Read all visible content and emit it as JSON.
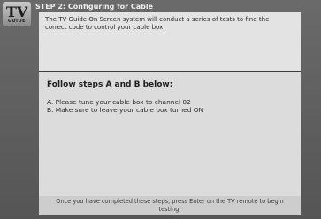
{
  "header": {
    "logo_top": "TV",
    "logo_bottom": "GUIDE",
    "title": "STEP 2: Configuring for Cable"
  },
  "intro": {
    "text": "The TV Guide On Screen system will conduct a series of tests to find the correct code to control your cable box."
  },
  "steps": {
    "heading": "Follow steps A and B below:",
    "items": [
      "A.  Please tune your cable box to channel 02",
      "B.  Make sure to leave your cable box turned ON"
    ]
  },
  "footer": {
    "text": "Once you have completed these steps, press Enter on the TV remote to begin testing."
  }
}
